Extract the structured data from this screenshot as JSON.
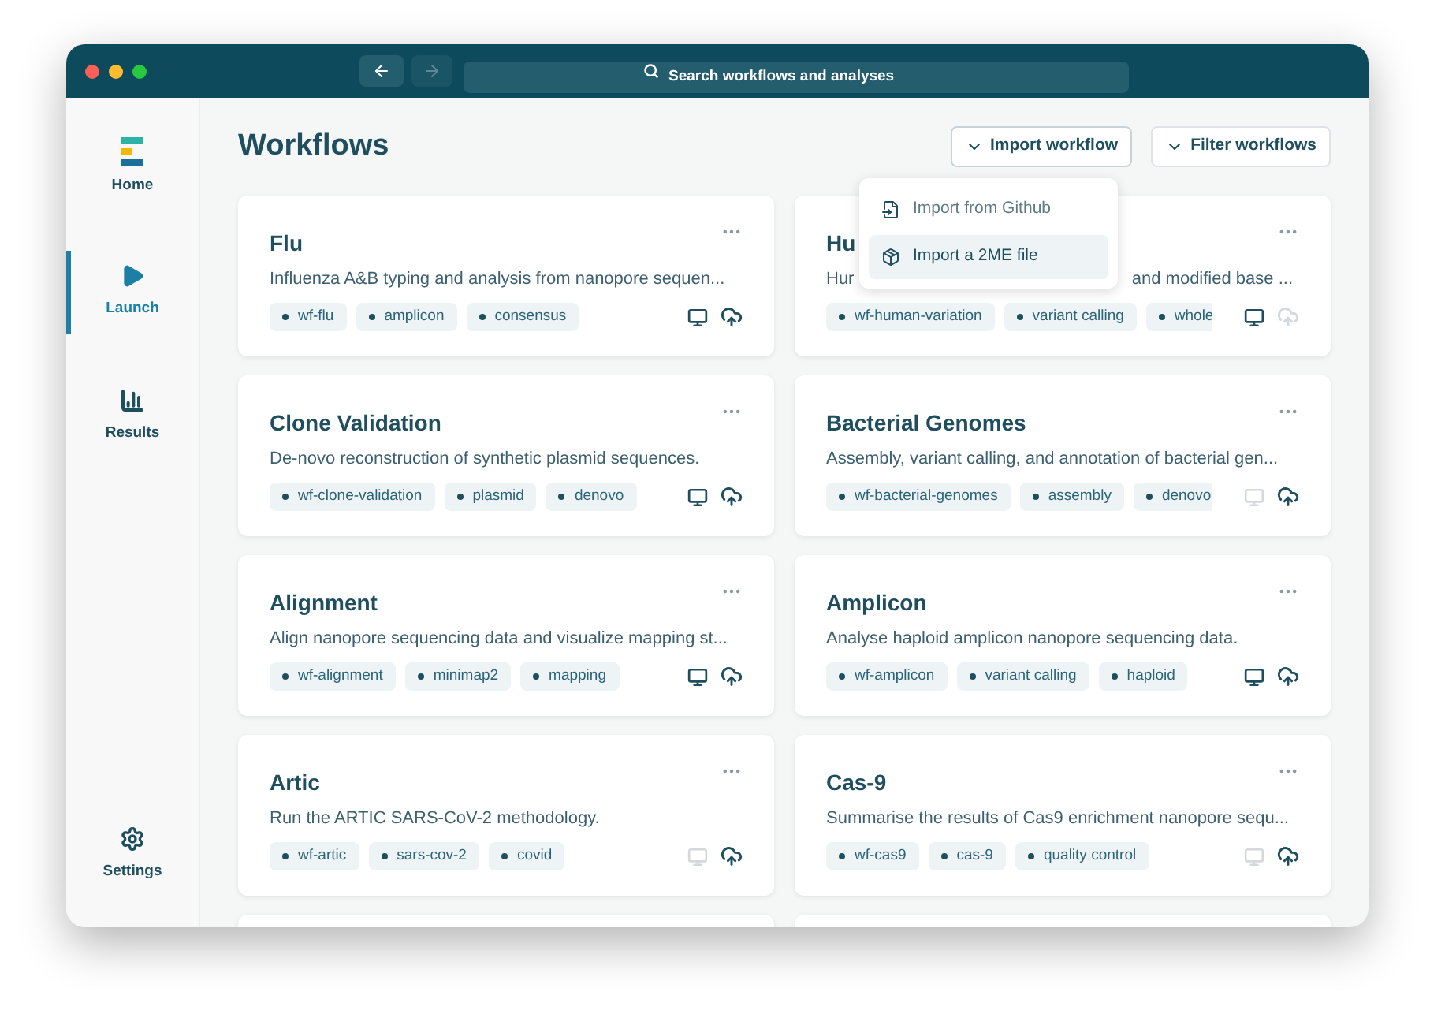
{
  "toolbar": {
    "back": {
      "disabled": false
    },
    "forward": {
      "disabled": true
    },
    "search": {
      "placeholder": "Search workflows and analyses"
    }
  },
  "sidebar": {
    "items": [
      {
        "kind": "home",
        "label": "Home",
        "selected": false
      },
      {
        "kind": "launch",
        "label": "Launch",
        "selected": true
      },
      {
        "kind": "results",
        "label": "Results",
        "selected": false
      }
    ],
    "footer_item": {
      "kind": "settings",
      "label": "Settings",
      "selected": false
    }
  },
  "page": {
    "title": "Workflows",
    "buttons": [
      {
        "label": "Import workflow",
        "expanded": true
      },
      {
        "label": "Filter workflows",
        "expanded": false
      }
    ]
  },
  "import_menu": {
    "items": [
      {
        "kind": "github",
        "label": "Import from Github",
        "selected": false
      },
      {
        "kind": "file",
        "label": "Import a 2ME file",
        "selected": true
      }
    ]
  },
  "cards": [
    {
      "title": "Flu",
      "description": "Influenza A&B typing and analysis from nanopore sequen...",
      "tags": [
        "wf-flu",
        "amplicon",
        "consensus"
      ],
      "local": true,
      "cloud": true
    },
    {
      "title": "Hu",
      "description": "Hur",
      "description_tail": "and modified base ...",
      "tags": [
        "wf-human-variation",
        "variant calling",
        "whole"
      ],
      "local": true,
      "cloud": false
    },
    {
      "title": "Clone Validation",
      "description": "De-novo reconstruction of synthetic plasmid sequences.",
      "tags": [
        "wf-clone-validation",
        "plasmid",
        "denovo"
      ],
      "local": true,
      "cloud": true
    },
    {
      "title": "Bacterial Genomes",
      "description": "Assembly, variant calling, and annotation of bacterial gen...",
      "tags": [
        "wf-bacterial-genomes",
        "assembly",
        "denovo"
      ],
      "local": false,
      "cloud": true
    },
    {
      "title": "Alignment",
      "description": "Align nanopore sequencing data and visualize mapping st...",
      "tags": [
        "wf-alignment",
        "minimap2",
        "mapping"
      ],
      "local": true,
      "cloud": true
    },
    {
      "title": "Amplicon",
      "description": "Analyse haploid amplicon nanopore sequencing data.",
      "tags": [
        "wf-amplicon",
        "variant calling",
        "haploid"
      ],
      "local": true,
      "cloud": true
    },
    {
      "title": "Artic",
      "description": "Run the ARTIC SARS-CoV-2 methodology.",
      "tags": [
        "wf-artic",
        "sars-cov-2",
        "covid"
      ],
      "local": false,
      "cloud": true
    },
    {
      "title": "Cas-9",
      "description": "Summarise the results of Cas9 enrichment nanopore sequ...",
      "tags": [
        "wf-cas9",
        "cas-9",
        "quality control"
      ],
      "local": false,
      "cloud": true
    }
  ]
}
